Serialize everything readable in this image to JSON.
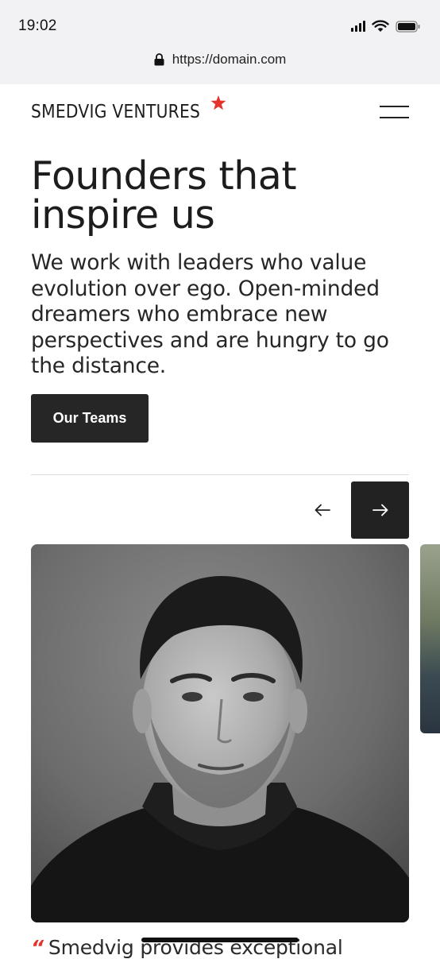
{
  "status_bar": {
    "time": "19:02"
  },
  "browser": {
    "url": "https://domain.com"
  },
  "header": {
    "logo_text": "SMEDVIG VENTURES"
  },
  "hero": {
    "title": "Founders that inspire us",
    "body": "We work with leaders who value evolution over ego. Open-minded dreamers who embrace new perspectives and are hungry to go the distance.",
    "cta_label": "Our Teams"
  },
  "quote": {
    "mark": "“",
    "text": "Smedvig provides exceptional"
  },
  "colors": {
    "accent": "#e5322d",
    "dark": "#222222",
    "chrome": "#f2f2f4"
  },
  "icons": [
    "lock-icon",
    "signal-icon",
    "wifi-icon",
    "battery-icon",
    "star-icon",
    "hamburger-menu-icon",
    "arrow-left-icon",
    "arrow-right-icon"
  ]
}
